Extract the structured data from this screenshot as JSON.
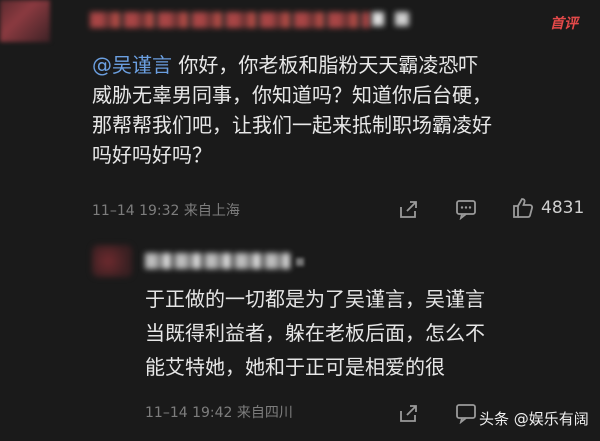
{
  "header": {
    "badge_text": "首评",
    "badge_color": "#e34949"
  },
  "comment": {
    "mention": "@吴谨言",
    "text_line1": " 你好，你老板和脂粉天天霸凌恐吓",
    "text_line2": "威胁无辜男同事，你知道吗？知道你后台硬，",
    "text_line3": "那帮帮我们吧，让我们一起来抵制职场霸凌好",
    "text_line4": "吗好吗好吗？",
    "meta": "11–14 19:32  来自上海",
    "like_count": "4831",
    "mention_color": "#6b9fe0"
  },
  "reply": {
    "text_line1": "于正做的一切都是为了吴谨言，吴谨言",
    "text_line2": "当既得利益者，躲在老板后面，怎么不",
    "text_line3": "能艾特她，她和于正可是相爱的很",
    "meta": "11–14 19:42  来自四川"
  },
  "watermark": {
    "text": "头条 @娱乐有阔"
  },
  "icons": {
    "share": "share-icon",
    "comment": "comment-icon",
    "like": "thumbs-up-icon",
    "more": "more-icon"
  }
}
